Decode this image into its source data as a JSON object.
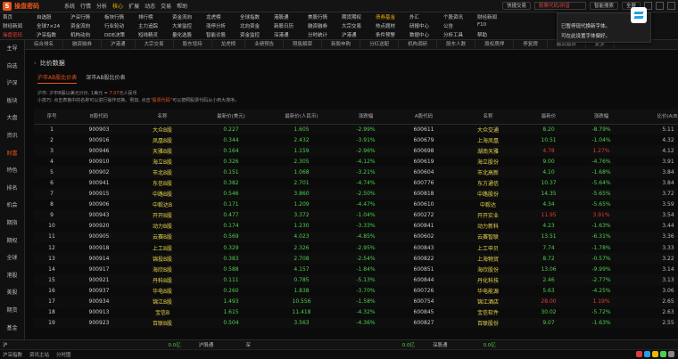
{
  "app": {
    "name": "操盘密码",
    "badge_letter": "S"
  },
  "menu": [
    "系统",
    "行情",
    "分析",
    "核心",
    "扩展",
    "动态",
    "交易",
    "帮助"
  ],
  "menu_active_index": 3,
  "topbar": {
    "search_placeholder": "股票代码/拼音",
    "vip_label": "快捷交易",
    "ai_label": "智能搜索",
    "full_label": "全屏",
    "full2_label": "缩小"
  },
  "quick_rows": [
    [
      "首页",
      "自选股",
      "沪深行情",
      "板块行情",
      "排行榜",
      "资金流向",
      "龙虎榜",
      "全球指数",
      "港股通",
      "美股行情",
      "期货期权",
      "债券基金",
      "外汇",
      "个股资讯",
      "财经新闻"
    ],
    [
      "财经新闻",
      "全球7×24",
      "资金流向",
      "行业轮动",
      "主力追踪",
      "大单监控",
      "涨停分析",
      "北向资金",
      "新股日历",
      "融资融券",
      "大宗交易",
      "热点题材",
      "研报中心",
      "公告",
      "F10"
    ],
    [
      "操盘密码",
      "沪深指数",
      "机构动向",
      "DDE决策",
      "短线精灵",
      "量化选股",
      "智能诊股",
      "资金监控",
      "深港通",
      "分时统计",
      "沪港通",
      "条件预警",
      "数据中心",
      "分析工具",
      "帮助"
    ]
  ],
  "sidebar": [
    "主导",
    "自选",
    "沪深",
    "板块",
    "大盘",
    "资讯",
    "财富",
    "特色",
    "排名",
    "机会",
    "期指",
    "期权",
    "全球",
    "港股",
    "美股",
    "期货",
    "基金",
    "债券",
    "外汇",
    "交易"
  ],
  "sidebar_active_index": 6,
  "tabs": [
    "综合排名",
    "融资融券",
    "沪港通",
    "大宗交易",
    "股东增持",
    "龙虎榜",
    "业绩预告",
    "限售解禁",
    "新股申购",
    "分红送配",
    "机构调研",
    "股东人数",
    "股权质押",
    "停复牌",
    "融资融券",
    "更多"
  ],
  "page_title": "比价数据",
  "subtabs": [
    "沪市AB股比价表",
    "深市AB股比价表"
  ],
  "subtab_active": 0,
  "notes": {
    "line1_a": "沪市: 沪市B股以美元计价, 1美元 = ",
    "line1_v": "7.07",
    "line1_b": "元人民币",
    "line2_a": "小技巧: 点击表格中的名称可以进行操作切换。例如, 点击",
    "line2_v": "\"股票代码\"",
    "line2_b": "可以按照股票代码从小到大排序。"
  },
  "columns": [
    "序号",
    "B股代码",
    "名称",
    "最新价(美元)",
    "最新价(人民币)",
    "涨跌幅",
    "A股代码",
    "名称",
    "最新价",
    "涨跌幅",
    "比价(A/B)"
  ],
  "rows": [
    [
      "1",
      "900903",
      "大众B股",
      "0.227",
      "1.605",
      "-2.99%",
      "600611",
      "大众交通",
      "8.20",
      "-8.79%",
      "5.11"
    ],
    [
      "2",
      "900916",
      "凤凰B股",
      "0.344",
      "2.432",
      "-3.91%",
      "600679",
      "上海凤凰",
      "10.51",
      "-1.04%",
      "4.32"
    ],
    [
      "3",
      "900946",
      "天雅B股",
      "0.164",
      "1.159",
      "-2.96%",
      "600698",
      "湖南天雅",
      "4.78",
      "1.27%",
      "4.12"
    ],
    [
      "4",
      "900910",
      "海立B股",
      "0.326",
      "2.305",
      "-4.12%",
      "600619",
      "海立股份",
      "9.00",
      "-4.76%",
      "3.91"
    ],
    [
      "5",
      "900902",
      "市北B股",
      "0.151",
      "1.068",
      "-3.21%",
      "600604",
      "市北高新",
      "4.10",
      "-1.68%",
      "3.84"
    ],
    [
      "6",
      "900941",
      "东信B股",
      "0.382",
      "2.701",
      "-4.74%",
      "600776",
      "东方通信",
      "10.37",
      "-5.64%",
      "3.84"
    ],
    [
      "7",
      "900915",
      "中路B股",
      "0.546",
      "3.860",
      "-2.50%",
      "600818",
      "中路股份",
      "14.35",
      "-5.65%",
      "3.72"
    ],
    [
      "8",
      "900906",
      "中毅达B",
      "0.171",
      "1.209",
      "-4.47%",
      "600610",
      "中毅达",
      "4.34",
      "-5.65%",
      "3.59"
    ],
    [
      "9",
      "900943",
      "开开B股",
      "0.477",
      "3.372",
      "-1.04%",
      "600272",
      "开开实业",
      "11.95",
      "3.91%",
      "3.54"
    ],
    [
      "10",
      "900920",
      "动力B股",
      "0.174",
      "1.230",
      "-3.33%",
      "600841",
      "动力新科",
      "4.23",
      "-1.63%",
      "3.44"
    ],
    [
      "11",
      "900905",
      "云赛B股",
      "0.569",
      "4.023",
      "-4.85%",
      "600602",
      "云赛智联",
      "13.51",
      "-6.31%",
      "3.36"
    ],
    [
      "12",
      "900918",
      "上工B股",
      "0.329",
      "2.326",
      "-2.95%",
      "600843",
      "上工申贝",
      "7.74",
      "-1.78%",
      "3.33"
    ],
    [
      "13",
      "900914",
      "锦投B股",
      "0.383",
      "2.708",
      "-2.54%",
      "600822",
      "上海物贸",
      "8.72",
      "-0.57%",
      "3.22"
    ],
    [
      "14",
      "900917",
      "海欣B股",
      "0.588",
      "4.157",
      "-1.84%",
      "600851",
      "海欣股份",
      "13.06",
      "-9.99%",
      "3.14"
    ],
    [
      "15",
      "900921",
      "丹科B股",
      "0.111",
      "0.785",
      "-5.13%",
      "600844",
      "丹化科技",
      "2.46",
      "-2.77%",
      "3.13"
    ],
    [
      "16",
      "900937",
      "华电B股",
      "0.260",
      "1.838",
      "-3.70%",
      "600726",
      "华电能源",
      "5.63",
      "-4.25%",
      "3.06"
    ],
    [
      "17",
      "900934",
      "锦江B股",
      "1.493",
      "10.556",
      "-1.58%",
      "600754",
      "锦江酒店",
      "28.00",
      "1.19%",
      "2.65"
    ],
    [
      "18",
      "900913",
      "宝信B",
      "1.615",
      "11.418",
      "-4.32%",
      "600845",
      "宝信软件",
      "30.02",
      "-5.72%",
      "2.63"
    ],
    [
      "19",
      "900923",
      "百联B股",
      "0.504",
      "3.563",
      "-4.36%",
      "600827",
      "百联股份",
      "9.07",
      "-1.63%",
      "2.55"
    ]
  ],
  "row_a_price_up": [
    false,
    false,
    true,
    false,
    false,
    false,
    false,
    false,
    true,
    false,
    false,
    false,
    false,
    false,
    false,
    false,
    true,
    false,
    false
  ],
  "row_a_chg_up": [
    false,
    false,
    true,
    false,
    false,
    false,
    false,
    false,
    true,
    false,
    false,
    false,
    false,
    false,
    false,
    false,
    true,
    false,
    false
  ],
  "notice": {
    "line1": "已暂停现代换新字体。",
    "line2": "可在此设置字体偏好。"
  },
  "status": {
    "sh_label": "沪",
    "sh_val": "0.0亿",
    "sz_label": "深",
    "sz_val": "0.0亿",
    "hk_label": "沪股通",
    "hk_val": "0.0亿",
    "sz2_label": "深股通",
    "sz2_val": "0.0亿"
  },
  "taskbar": {
    "start": "沪深指数",
    "item1": "资讯主站",
    "item2": "分时图"
  },
  "colors": {
    "accent": "#e8551a",
    "up": "#e03b3b",
    "down": "#4dd04d",
    "name": "#e8d44d"
  }
}
